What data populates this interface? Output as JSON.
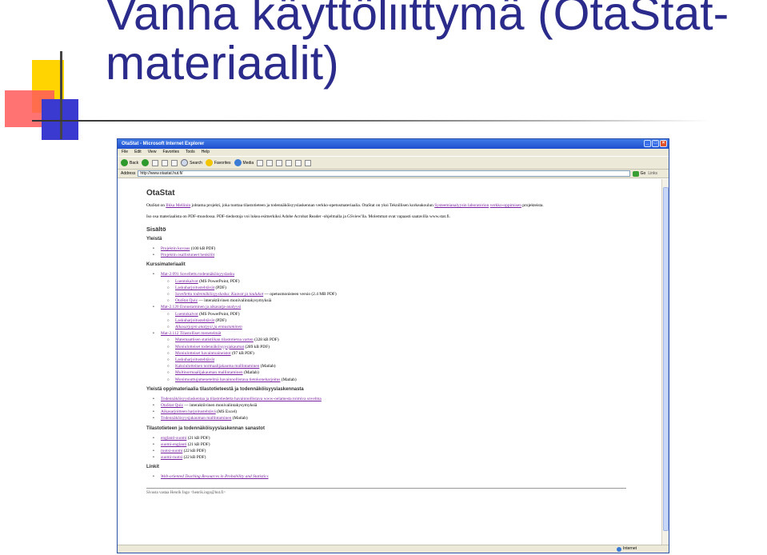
{
  "slide": {
    "title": "Vanha käyttöliittymä (OtaStat-\nmateriaalit)"
  },
  "browser": {
    "title": "OtaStat - Microsoft Internet Explorer",
    "menu": [
      "File",
      "Edit",
      "View",
      "Favorites",
      "Tools",
      "Help"
    ],
    "toolbar": {
      "back": "Back",
      "search": "Search",
      "favorites": "Favorites",
      "media": "Media"
    },
    "address_label": "Address",
    "address": "http://www.otastat.hut.fi/",
    "go": "Go",
    "links": "Links",
    "status_zone": "Internet"
  },
  "page": {
    "heading": "OtaStat",
    "intro": {
      "p1_a": "OtaStat on ",
      "p1_link1": "Ilkka Mellinin",
      "p1_b": " johtama projekti, joka tuottaa tilastotieteen ja todennäköisyyslaskennan verkko-opetusmateriaalia. OtaStat on yksi Teknillisen korkeakoulun ",
      "p1_link2": "Systeemianalyysin laboratorion",
      "p1_c": " ",
      "p1_link3": "verkko-oppimisen",
      "p1_d": " projekteista.",
      "p2": "Iso osa materiaalista on PDF-muodossa. PDF-tiedostoja voi lukea esimerkiksi Adobe Acrobat Reader -ohjelmalla ja GSview'lla. Molemmat ovat vapaasti saatavilla www.stat.fi."
    },
    "sisalto": "Sisältö",
    "vielta": {
      "heading": "Yleistä",
      "items": [
        {
          "link": "Projektin kuvaus",
          "note": " (100 kB PDF)"
        },
        {
          "link": "Projektin osallistuneet henkilöt",
          "note": ""
        }
      ]
    },
    "kurssi": {
      "heading": "Kurssimateriaalit",
      "courses": [
        {
          "link": "Mat-2.091 Sovellettu todennäköisyyslasku",
          "sub": [
            {
              "link": "Luentokalvot",
              "note": " (MS PowerPoint, PDF)",
              "italic": false
            },
            {
              "link": "Laskuharjoitustehtävät",
              "note": " (PDF)",
              "italic": false
            },
            {
              "link": "Sovellettu todennäköisyyslasku: Kaavat ja taulukot",
              "note": " — opetusmonisteen versio (2.4 MB PDF)",
              "italic": true
            },
            {
              "link": "OtaStat Quiz",
              "note": " — interaktiivinen monivalintakysymyksiä",
              "italic": false
            }
          ]
        },
        {
          "link": "Mat-2.120 Ennustaminen ja aikasarja-analyysi",
          "sub": [
            {
              "link": "Luentokalvot",
              "note": " (MS PowerPoint, PDF)",
              "italic": false
            },
            {
              "link": "Laskuharjoitustehtävät",
              "note": " (PDF)",
              "italic": false
            },
            {
              "link": "Aikasarjojen analyysi ja ennustaminen",
              "note": "",
              "italic": true
            }
          ]
        },
        {
          "link": "Mat-2.112 Tilastolliset menetelmät",
          "sub": [
            {
              "link": "Matemaattisen statistiikan tilastotietoa varten",
              "note": " (328 kB PDF)",
              "italic": false
            },
            {
              "link": "Moniulotteiset todennäköisyysjakaumat",
              "note": " (289 kB PDF)",
              "italic": false
            },
            {
              "link": "Moniulotteiset havaintoaineistot",
              "note": " (97 kB PDF)",
              "italic": false
            },
            {
              "link": "Laskuharjoitustehtävät",
              "note": "",
              "italic": false
            },
            {
              "link": "Kaksiulotteinen normaalijakauma mallintaminen",
              "note": " (Matlab)",
              "italic": false
            },
            {
              "link": "Multinormaalijakauman mallintaminen",
              "note": " (Matlab)",
              "italic": false
            },
            {
              "link": "Monimuuttujamenetelmä havainnollistava tietokoneharjoitus",
              "note": " (Matlab)",
              "italic": false
            }
          ]
        }
      ]
    },
    "yleista": {
      "heading": "Yleistä oppimateriaalia tilastotieteestä ja todennäköisyyslaskennasta",
      "items": [
        {
          "link": "Todennäköisyyslaskentaa ja tilastotiedetta havainnollistava www-oelamesta toimiva sovelma",
          "note": ""
        },
        {
          "link": "OtaStat Quiz",
          "note": " — interaktiivinen monivalintakysymyksiä"
        },
        {
          "link": "Aikasarjoitteen harjoitustehtävä",
          "note": " (MS Excel)"
        },
        {
          "link": "Todennäköisyysjakauman mallintaminen",
          "note": " (Matlab)"
        }
      ]
    },
    "sanastot": {
      "heading": "Tilastotieteen ja todennäköisyyslaskennan sanastot",
      "items": [
        {
          "link": "englanti-suomi",
          "note": " (21 kB PDF)"
        },
        {
          "link": "suomi-englanti",
          "note": " (21 kB PDF)"
        },
        {
          "link": "ruotsi-suomi",
          "note": " (22 kB PDF)"
        },
        {
          "link": "suomi-ruotsi",
          "note": " (22 kB PDF)"
        }
      ]
    },
    "linkit": {
      "heading": "Linkit",
      "items": [
        {
          "link": "Web-oriented Teaching Resources in Probability and Statistics"
        }
      ]
    },
    "footer": "Sivusta vastaa Henrik Ingo <henrik.ingo@hut.fi>"
  },
  "colors": {
    "title": "#2b2b8c",
    "link": "#7b1fa2",
    "xp_title": "#1f4fcf",
    "xp_chrome": "#ece9d8"
  }
}
